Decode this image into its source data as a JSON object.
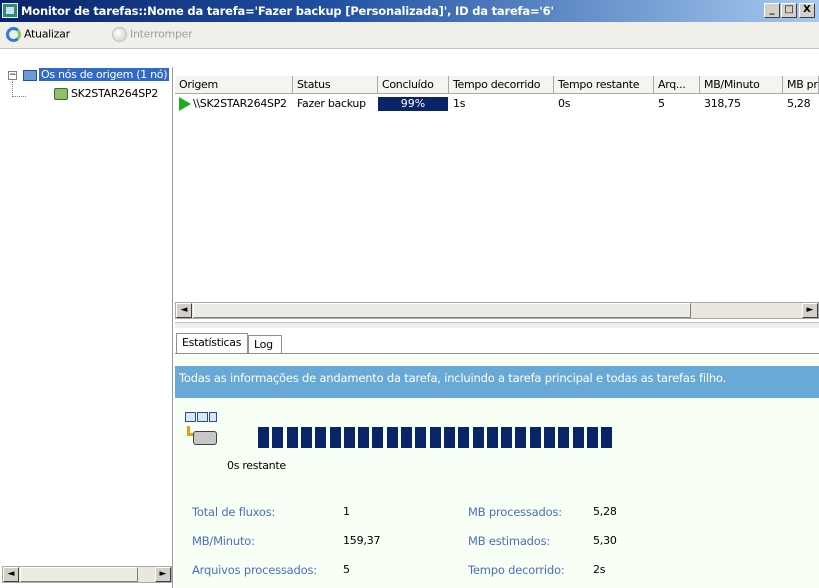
{
  "window": {
    "title": "Monitor de tarefas::Nome da tarefa='Fazer backup [Personalizada]', ID da tarefa='6'",
    "minimize_glyph": "_",
    "maximize_glyph": "□",
    "close_glyph": "X"
  },
  "toolbar": {
    "refresh_label": "Atualizar",
    "stop_label": "Interromper"
  },
  "tree": {
    "root_label": "Os nós de origem (1 nó)",
    "child_label": "SK2STAR264SP2",
    "expander_glyph": "−"
  },
  "grid": {
    "columns": [
      "Origem",
      "Status",
      "Concluído",
      "Tempo decorrido",
      "Tempo restante",
      "Arq...",
      "MB/Minuto",
      "MB processados"
    ],
    "rows": [
      {
        "origin": "\\\\SK2STAR264SP2",
        "status": "Fazer backup",
        "completed": "99%",
        "elapsed": "1s",
        "remaining": "0s",
        "files": "5",
        "mb_per_minute": "318,75",
        "mb_processed": "5,28"
      }
    ]
  },
  "tabs": [
    "Estatísticas",
    "Log"
  ],
  "stats": {
    "header": "Todas as informações de andamento da tarefa, incluindo a tarefa principal e todas as tarefas filho.",
    "progress_fraction": 0.99,
    "remaining_text": "0s restante",
    "labels": {
      "total_streams": "Total de fluxos:",
      "mb_per_minute": "MB/Minuto:",
      "files_processed": "Arquivos processados:",
      "mb_processed": "MB processados:",
      "mb_estimated": "MB estimados:",
      "elapsed_time": "Tempo decorrido:"
    },
    "values": {
      "total_streams": "1",
      "mb_per_minute": "159,37",
      "files_processed": "5",
      "mb_processed": "5,28",
      "mb_estimated": "5,30",
      "elapsed_time": "2s"
    }
  },
  "scroll": {
    "left_glyph": "◄",
    "right_glyph": "►"
  }
}
